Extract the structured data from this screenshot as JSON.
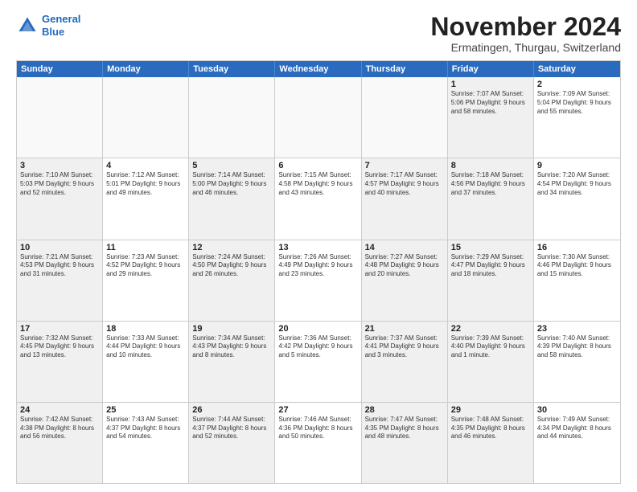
{
  "header": {
    "logo_line1": "General",
    "logo_line2": "Blue",
    "main_title": "November 2024",
    "subtitle": "Ermatingen, Thurgau, Switzerland"
  },
  "days_of_week": [
    "Sunday",
    "Monday",
    "Tuesday",
    "Wednesday",
    "Thursday",
    "Friday",
    "Saturday"
  ],
  "weeks": [
    [
      {
        "day": "",
        "text": "",
        "empty": true
      },
      {
        "day": "",
        "text": "",
        "empty": true
      },
      {
        "day": "",
        "text": "",
        "empty": true
      },
      {
        "day": "",
        "text": "",
        "empty": true
      },
      {
        "day": "",
        "text": "",
        "empty": true
      },
      {
        "day": "1",
        "text": "Sunrise: 7:07 AM\nSunset: 5:06 PM\nDaylight: 9 hours\nand 58 minutes.",
        "shaded": true
      },
      {
        "day": "2",
        "text": "Sunrise: 7:09 AM\nSunset: 5:04 PM\nDaylight: 9 hours\nand 55 minutes.",
        "shaded": false
      }
    ],
    [
      {
        "day": "3",
        "text": "Sunrise: 7:10 AM\nSunset: 5:03 PM\nDaylight: 9 hours\nand 52 minutes.",
        "shaded": true
      },
      {
        "day": "4",
        "text": "Sunrise: 7:12 AM\nSunset: 5:01 PM\nDaylight: 9 hours\nand 49 minutes.",
        "shaded": false
      },
      {
        "day": "5",
        "text": "Sunrise: 7:14 AM\nSunset: 5:00 PM\nDaylight: 9 hours\nand 46 minutes.",
        "shaded": true
      },
      {
        "day": "6",
        "text": "Sunrise: 7:15 AM\nSunset: 4:58 PM\nDaylight: 9 hours\nand 43 minutes.",
        "shaded": false
      },
      {
        "day": "7",
        "text": "Sunrise: 7:17 AM\nSunset: 4:57 PM\nDaylight: 9 hours\nand 40 minutes.",
        "shaded": true
      },
      {
        "day": "8",
        "text": "Sunrise: 7:18 AM\nSunset: 4:56 PM\nDaylight: 9 hours\nand 37 minutes.",
        "shaded": true
      },
      {
        "day": "9",
        "text": "Sunrise: 7:20 AM\nSunset: 4:54 PM\nDaylight: 9 hours\nand 34 minutes.",
        "shaded": false
      }
    ],
    [
      {
        "day": "10",
        "text": "Sunrise: 7:21 AM\nSunset: 4:53 PM\nDaylight: 9 hours\nand 31 minutes.",
        "shaded": true
      },
      {
        "day": "11",
        "text": "Sunrise: 7:23 AM\nSunset: 4:52 PM\nDaylight: 9 hours\nand 29 minutes.",
        "shaded": false
      },
      {
        "day": "12",
        "text": "Sunrise: 7:24 AM\nSunset: 4:50 PM\nDaylight: 9 hours\nand 26 minutes.",
        "shaded": true
      },
      {
        "day": "13",
        "text": "Sunrise: 7:26 AM\nSunset: 4:49 PM\nDaylight: 9 hours\nand 23 minutes.",
        "shaded": false
      },
      {
        "day": "14",
        "text": "Sunrise: 7:27 AM\nSunset: 4:48 PM\nDaylight: 9 hours\nand 20 minutes.",
        "shaded": true
      },
      {
        "day": "15",
        "text": "Sunrise: 7:29 AM\nSunset: 4:47 PM\nDaylight: 9 hours\nand 18 minutes.",
        "shaded": true
      },
      {
        "day": "16",
        "text": "Sunrise: 7:30 AM\nSunset: 4:46 PM\nDaylight: 9 hours\nand 15 minutes.",
        "shaded": false
      }
    ],
    [
      {
        "day": "17",
        "text": "Sunrise: 7:32 AM\nSunset: 4:45 PM\nDaylight: 9 hours\nand 13 minutes.",
        "shaded": true
      },
      {
        "day": "18",
        "text": "Sunrise: 7:33 AM\nSunset: 4:44 PM\nDaylight: 9 hours\nand 10 minutes.",
        "shaded": false
      },
      {
        "day": "19",
        "text": "Sunrise: 7:34 AM\nSunset: 4:43 PM\nDaylight: 9 hours\nand 8 minutes.",
        "shaded": true
      },
      {
        "day": "20",
        "text": "Sunrise: 7:36 AM\nSunset: 4:42 PM\nDaylight: 9 hours\nand 5 minutes.",
        "shaded": false
      },
      {
        "day": "21",
        "text": "Sunrise: 7:37 AM\nSunset: 4:41 PM\nDaylight: 9 hours\nand 3 minutes.",
        "shaded": true
      },
      {
        "day": "22",
        "text": "Sunrise: 7:39 AM\nSunset: 4:40 PM\nDaylight: 9 hours\nand 1 minute.",
        "shaded": true
      },
      {
        "day": "23",
        "text": "Sunrise: 7:40 AM\nSunset: 4:39 PM\nDaylight: 8 hours\nand 58 minutes.",
        "shaded": false
      }
    ],
    [
      {
        "day": "24",
        "text": "Sunrise: 7:42 AM\nSunset: 4:38 PM\nDaylight: 8 hours\nand 56 minutes.",
        "shaded": true
      },
      {
        "day": "25",
        "text": "Sunrise: 7:43 AM\nSunset: 4:37 PM\nDaylight: 8 hours\nand 54 minutes.",
        "shaded": false
      },
      {
        "day": "26",
        "text": "Sunrise: 7:44 AM\nSunset: 4:37 PM\nDaylight: 8 hours\nand 52 minutes.",
        "shaded": true
      },
      {
        "day": "27",
        "text": "Sunrise: 7:46 AM\nSunset: 4:36 PM\nDaylight: 8 hours\nand 50 minutes.",
        "shaded": false
      },
      {
        "day": "28",
        "text": "Sunrise: 7:47 AM\nSunset: 4:35 PM\nDaylight: 8 hours\nand 48 minutes.",
        "shaded": true
      },
      {
        "day": "29",
        "text": "Sunrise: 7:48 AM\nSunset: 4:35 PM\nDaylight: 8 hours\nand 46 minutes.",
        "shaded": true
      },
      {
        "day": "30",
        "text": "Sunrise: 7:49 AM\nSunset: 4:34 PM\nDaylight: 8 hours\nand 44 minutes.",
        "shaded": false
      }
    ]
  ]
}
